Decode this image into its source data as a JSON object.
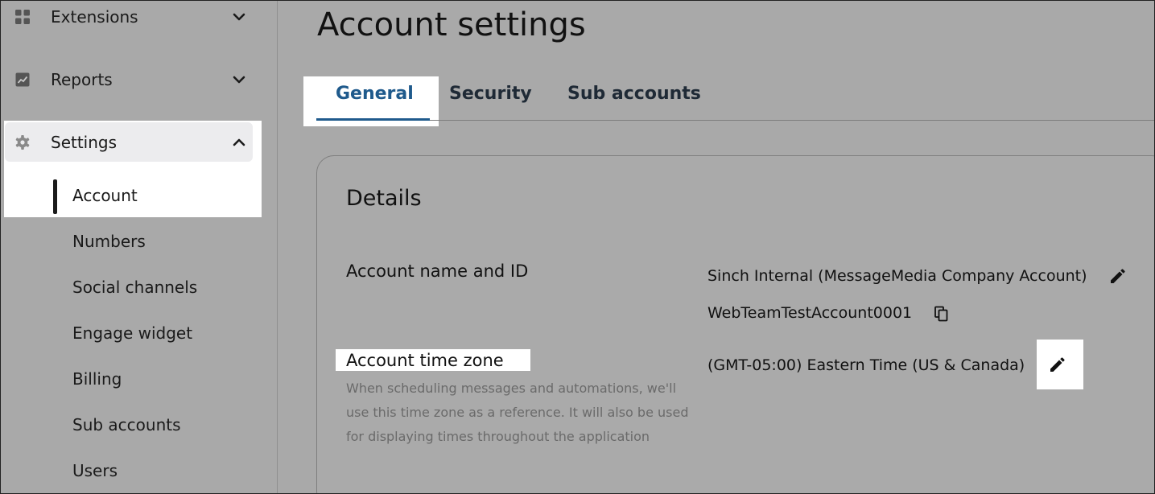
{
  "sidebar": {
    "items": [
      {
        "label": "Extensions",
        "icon": "grid-icon",
        "chevron": "chevron-down-icon"
      },
      {
        "label": "Reports",
        "icon": "chart-icon",
        "chevron": "chevron-down-icon"
      },
      {
        "label": "Settings",
        "icon": "gear-icon",
        "chevron": "chevron-up-icon"
      }
    ],
    "settings_sub": [
      "Account",
      "Numbers",
      "Social channels",
      "Engage widget",
      "Billing",
      "Sub accounts",
      "Users"
    ],
    "active_sub": "Account"
  },
  "page": {
    "title": "Account settings",
    "tabs": [
      {
        "label": "General",
        "active": true
      },
      {
        "label": "Security",
        "active": false
      },
      {
        "label": "Sub accounts",
        "active": false
      }
    ]
  },
  "details": {
    "title": "Details",
    "account_name_label": "Account name and ID",
    "account_name_value": "Sinch Internal (MessageMedia Company Account)",
    "account_id_value": "WebTeamTestAccount0001",
    "time_zone_label": "Account time zone",
    "time_zone_help": "When scheduling messages and automations, we'll use this time zone as a reference. It will also be used for displaying times throughout the application",
    "time_zone_value": "(GMT-05:00) Eastern Time (US & Canada)"
  },
  "colors": {
    "accent": "#1f5a8c",
    "background": "#a9a9a9",
    "highlight": "#ffffff"
  }
}
